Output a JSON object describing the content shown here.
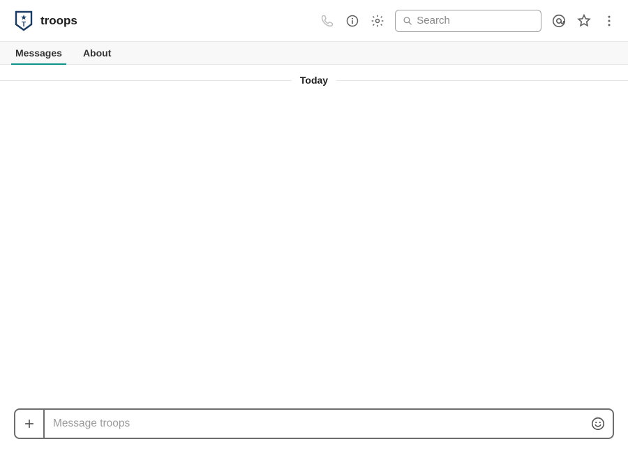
{
  "header": {
    "channel_name": "troops",
    "search_placeholder": "Search"
  },
  "tabs": {
    "messages": "Messages",
    "about": "About"
  },
  "divider_label": "Today",
  "composer": {
    "placeholder": "Message troops"
  }
}
